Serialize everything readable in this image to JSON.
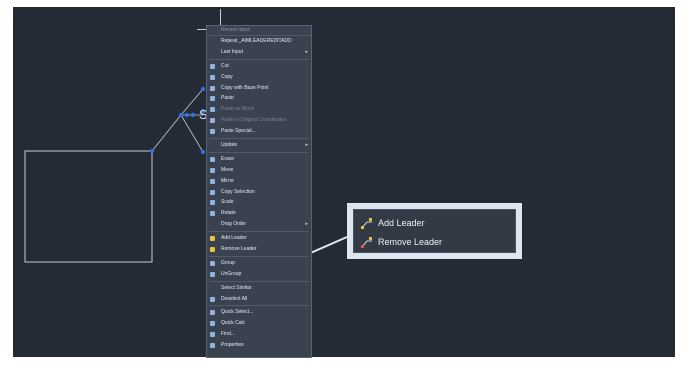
{
  "canvas": {
    "background": "#252b35",
    "dimension_text": "Siz"
  },
  "context_menu": {
    "title": "Recent Input",
    "items": [
      {
        "label": "Repeat _AIMLEADEREDITADD",
        "icon": "",
        "submenu": false,
        "disabled": false
      },
      {
        "label": "Last Input",
        "icon": "",
        "submenu": true,
        "disabled": false
      },
      {
        "sep": true
      },
      {
        "label": "Cut",
        "icon": "scissors-icon",
        "submenu": false,
        "disabled": false
      },
      {
        "label": "Copy",
        "icon": "copy-icon",
        "submenu": false,
        "disabled": false
      },
      {
        "label": "Copy with Base Point",
        "icon": "copy-base-icon",
        "submenu": false,
        "disabled": false
      },
      {
        "label": "Paste",
        "icon": "paste-icon",
        "submenu": false,
        "disabled": false
      },
      {
        "label": "Paste as Block",
        "icon": "paste-block-icon",
        "submenu": false,
        "disabled": true
      },
      {
        "label": "Paste to Original Coordinates",
        "icon": "paste-coords-icon",
        "submenu": false,
        "disabled": true
      },
      {
        "label": "Paste Special...",
        "icon": "paste-special-icon",
        "submenu": false,
        "disabled": false
      },
      {
        "sep": true
      },
      {
        "label": "Update",
        "icon": "",
        "submenu": true,
        "disabled": false
      },
      {
        "sep": true
      },
      {
        "label": "Erase",
        "icon": "eraser-icon",
        "submenu": false,
        "disabled": false
      },
      {
        "label": "Move",
        "icon": "move-icon",
        "submenu": false,
        "disabled": false
      },
      {
        "label": "Mirror",
        "icon": "mirror-icon",
        "submenu": false,
        "disabled": false
      },
      {
        "label": "Copy Selection",
        "icon": "copy-selection-icon",
        "submenu": false,
        "disabled": false
      },
      {
        "label": "Scale",
        "icon": "scale-icon",
        "submenu": false,
        "disabled": false
      },
      {
        "label": "Rotate",
        "icon": "rotate-icon",
        "submenu": false,
        "disabled": false
      },
      {
        "label": "Drag Order",
        "icon": "",
        "submenu": true,
        "disabled": false
      },
      {
        "sep": true
      },
      {
        "label": "Add Leader",
        "icon": "add-leader-icon",
        "submenu": false,
        "disabled": false
      },
      {
        "label": "Remove Leader",
        "icon": "remove-leader-icon",
        "submenu": false,
        "disabled": false
      },
      {
        "sep": true
      },
      {
        "label": "Group",
        "icon": "group-icon",
        "submenu": false,
        "disabled": false
      },
      {
        "label": "UnGroup",
        "icon": "ungroup-icon",
        "submenu": false,
        "disabled": false
      },
      {
        "sep": true
      },
      {
        "label": "Select Similar",
        "icon": "",
        "submenu": false,
        "disabled": false
      },
      {
        "label": "Deselect All",
        "icon": "deselect-icon",
        "submenu": false,
        "disabled": false
      },
      {
        "sep": true
      },
      {
        "label": "Quick Select...",
        "icon": "quick-select-icon",
        "submenu": false,
        "disabled": false
      },
      {
        "label": "Quick Calc",
        "icon": "calculator-icon",
        "submenu": false,
        "disabled": false
      },
      {
        "label": "Find...",
        "icon": "find-icon",
        "submenu": false,
        "disabled": false
      },
      {
        "label": "Properties",
        "icon": "properties-icon",
        "submenu": false,
        "disabled": false
      }
    ]
  },
  "callout": {
    "items": [
      {
        "label": "Add Leader",
        "icon": "add-leader-icon"
      },
      {
        "label": "Remove Leader",
        "icon": "remove-leader-icon"
      }
    ],
    "border_color": "#dde6f0"
  },
  "colors": {
    "grip_blue": "#2f6fe0",
    "line_gray": "#c9ccd1",
    "leader_icon_yellow": "#e8c33a"
  }
}
